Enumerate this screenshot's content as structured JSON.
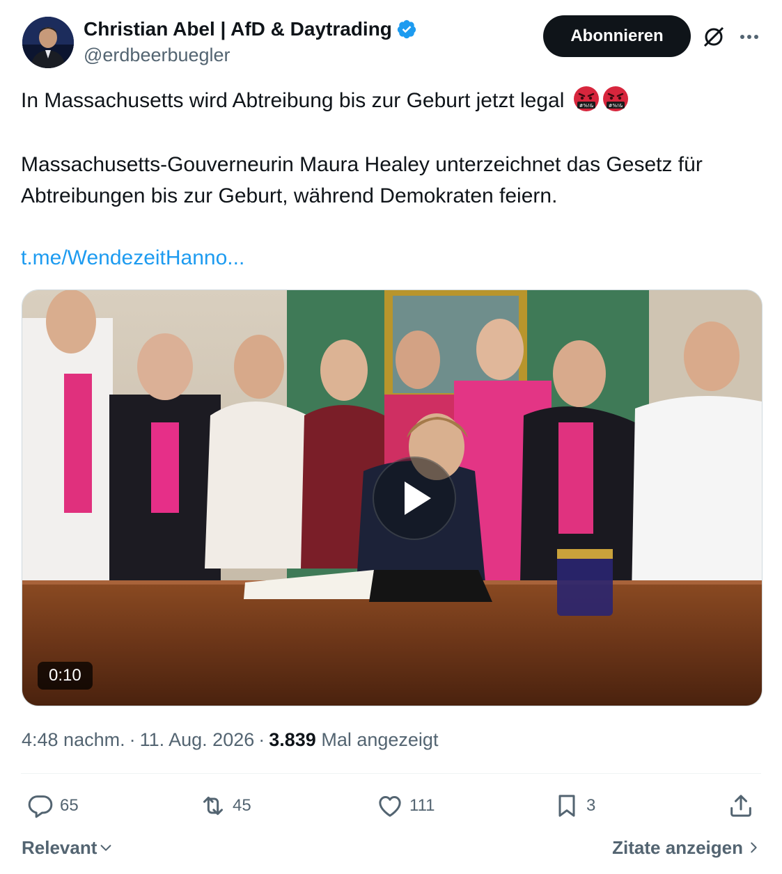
{
  "author": {
    "display_name": "Christian Abel | AfD & Daytrading",
    "handle": "@erdbeerbuegler",
    "verified": true,
    "avatar_icon": "profile-photo"
  },
  "header_actions": {
    "subscribe_label": "Abonnieren",
    "grok_icon": "grok-icon",
    "more_icon": "more-icon"
  },
  "tweet": {
    "line1": "In Massachusetts wird Abtreibung bis zur Geburt jetzt legal",
    "emoji": [
      "face-with-symbols-on-mouth",
      "face-with-symbols-on-mouth"
    ],
    "body": "Massachusetts-Gouverneurin Maura Healey unterzeichnet das Gesetz für Abtreibungen bis zur Geburt, während Demokraten feiern.",
    "link": "t.me/WendezeitHanno..."
  },
  "media": {
    "type": "video",
    "duration": "0:10",
    "play_icon": "play-icon"
  },
  "meta": {
    "time": "4:48 nachm.",
    "date": "11. Aug. 2026",
    "views_count": "3.839",
    "views_label": "Mal angezeigt"
  },
  "actions": {
    "replies": "65",
    "reposts": "45",
    "likes": "111",
    "bookmarks": "3"
  },
  "footer": {
    "sort_label": "Relevant",
    "quotes_label": "Zitate anzeigen"
  },
  "colors": {
    "link": "#1d9bf0",
    "verified": "#1d9bf0",
    "text": "#0f1419",
    "muted": "#536471",
    "button": "#0f1419"
  }
}
